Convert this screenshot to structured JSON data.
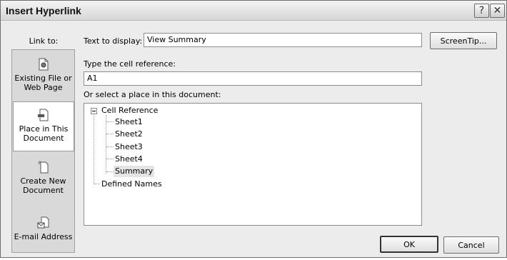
{
  "window": {
    "title": "Insert Hyperlink",
    "help_glyph": "?",
    "close_glyph": "✕"
  },
  "link_to": {
    "label": "Link to:",
    "items": [
      {
        "line1": "Existing File or",
        "line2": "Web Page",
        "icon": "existing-file-icon"
      },
      {
        "line1": "Place in This",
        "line2": "Document",
        "icon": "place-in-document-icon",
        "selected": true
      },
      {
        "line1": "Create New",
        "line2": "Document",
        "icon": "create-new-document-icon"
      },
      {
        "line1": "E-mail Address",
        "line2": "",
        "icon": "email-address-icon"
      }
    ]
  },
  "text_to_display": {
    "label": "Text to display:",
    "value": "View Summary"
  },
  "screentip_button": "ScreenTip...",
  "cell_reference": {
    "label": "Type the cell reference:",
    "value": "A1"
  },
  "place_label": "Or select a place in this document:",
  "tree": {
    "root": "Cell Reference",
    "children": [
      "Sheet1",
      "Sheet2",
      "Sheet3",
      "Sheet4",
      "Summary"
    ],
    "selected": "Summary",
    "other": "Defined Names"
  },
  "buttons": {
    "ok": "OK",
    "cancel": "Cancel"
  }
}
